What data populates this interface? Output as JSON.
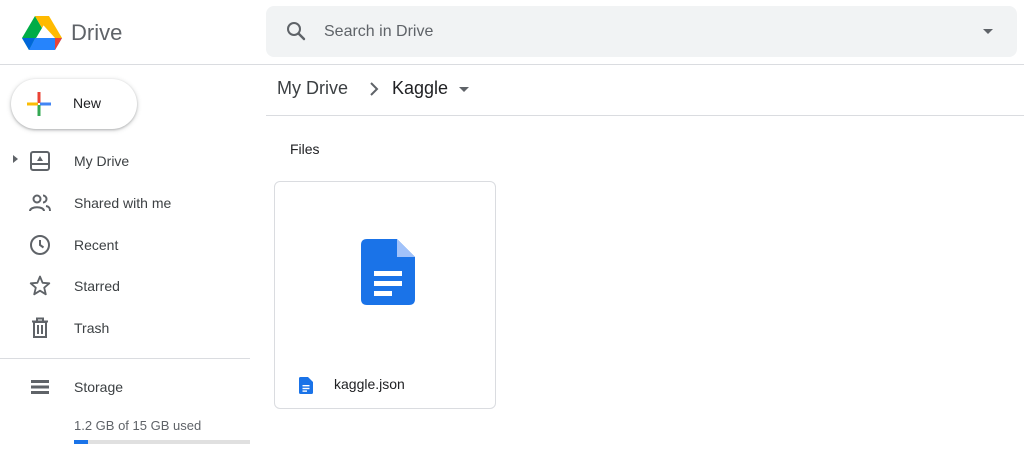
{
  "header": {
    "app_name": "Drive",
    "search": {
      "placeholder": "Search in Drive"
    }
  },
  "sidebar": {
    "new_label": "New",
    "items": [
      {
        "label": "My Drive",
        "icon": "my-drive-icon",
        "expandable": true
      },
      {
        "label": "Shared with me",
        "icon": "shared-icon"
      },
      {
        "label": "Recent",
        "icon": "clock-icon"
      },
      {
        "label": "Starred",
        "icon": "star-icon"
      },
      {
        "label": "Trash",
        "icon": "trash-icon"
      }
    ],
    "storage": {
      "label": "Storage",
      "icon": "storage-icon",
      "usage_text": "1.2 GB of 15 GB used",
      "used_fraction": 0.08
    }
  },
  "main": {
    "breadcrumb": {
      "root": "My Drive",
      "current": "Kaggle"
    },
    "section_title": "Files",
    "files": [
      {
        "name": "kaggle.json",
        "icon": "document-icon"
      }
    ]
  },
  "colors": {
    "accent": "#1a73e8",
    "doc_blue": "#1a73e8",
    "divider": "#dadce0",
    "search_bg": "#f1f3f4"
  }
}
